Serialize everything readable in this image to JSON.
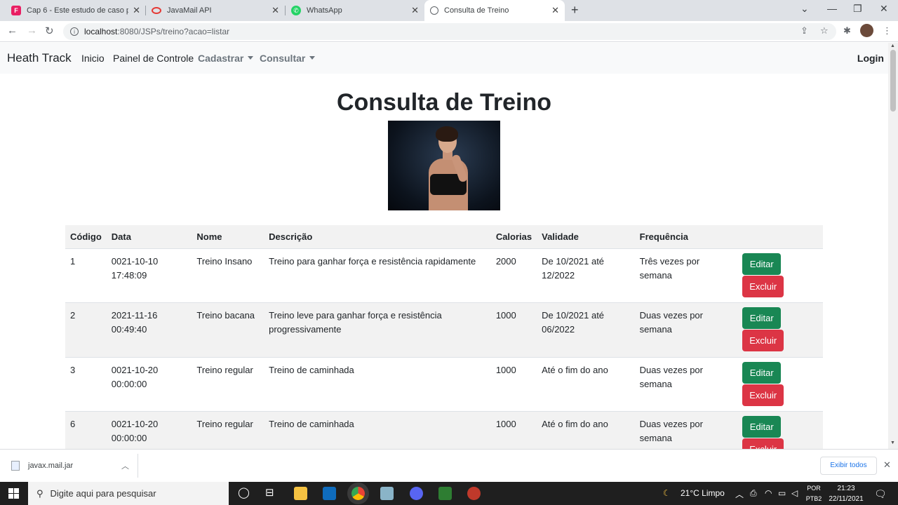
{
  "browser": {
    "tabs": [
      {
        "title": "Cap 6 - Este estudo de caso pode",
        "favicon_color": "#e91e63",
        "favicon_letter": "F"
      },
      {
        "title": "JavaMail API",
        "favicon_color": "#e53935",
        "favicon_letter": "O"
      },
      {
        "title": "WhatsApp",
        "favicon_color": "#25d366",
        "favicon_letter": "W"
      },
      {
        "title": "Consulta de Treino",
        "favicon_color": "#5f6368",
        "favicon_letter": "G"
      }
    ],
    "url_host": "localhost",
    "url_path": ":8080/JSPs/treino?acao=listar"
  },
  "navbar": {
    "brand": "Heath Track",
    "inicio": "Inicio",
    "painel": "Painel de Controle",
    "cadastrar": "Cadastrar",
    "consultar": "Consultar",
    "login": "Login"
  },
  "page": {
    "title": "Consulta de Treino"
  },
  "table": {
    "headers": [
      "Código",
      "Data",
      "Nome",
      "Descrição",
      "Calorias",
      "Validade",
      "Frequência"
    ],
    "rows": [
      {
        "codigo": "1",
        "data": "0021-10-10 17:48:09",
        "nome": "Treino Insano",
        "descricao": "Treino para ganhar força e resistência rapidamente",
        "calorias": "2000",
        "validade": "De 10/2021 até 12/2022",
        "frequencia": "Três vezes por semana"
      },
      {
        "codigo": "2",
        "data": "2021-11-16 00:49:40",
        "nome": "Treino bacana",
        "descricao": "Treino leve para ganhar força e resistência progressivamente",
        "calorias": "1000",
        "validade": "De 10/2021 até 06/2022",
        "frequencia": "Duas vezes por semana"
      },
      {
        "codigo": "3",
        "data": "0021-10-20 00:00:00",
        "nome": "Treino regular",
        "descricao": "Treino de caminhada",
        "calorias": "1000",
        "validade": "Até o fim do ano",
        "frequencia": "Duas vezes por semana"
      },
      {
        "codigo": "6",
        "data": "0021-10-20 00:00:00",
        "nome": "Treino regular",
        "descricao": "Treino de caminhada",
        "calorias": "1000",
        "validade": "Até o fim do ano",
        "frequencia": "Duas vezes por semana"
      }
    ],
    "edit_label": "Editar",
    "delete_label": "Excluir"
  },
  "downloads": {
    "file": "javax.mail.jar",
    "show_all": "Exibir todos"
  },
  "taskbar": {
    "search_placeholder": "Digite aqui para pesquisar",
    "weather": "21°C  Limpo",
    "lang_1": "POR",
    "lang_2": "PTB2",
    "time": "21:23",
    "date": "22/11/2021"
  },
  "colors": {
    "edit": "#198754",
    "delete": "#dc3545",
    "navbar_bg": "#f8f9fa"
  }
}
